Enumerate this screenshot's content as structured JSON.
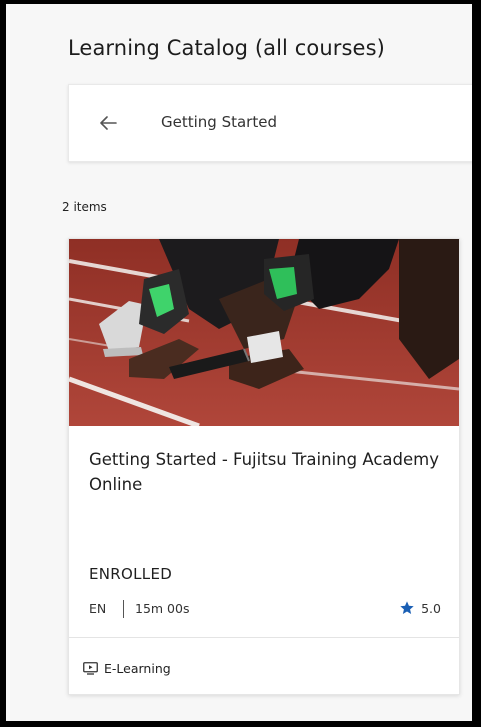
{
  "header": {
    "title": "Learning Catalog (all courses)"
  },
  "nav": {
    "back_icon": "arrow-left-icon",
    "label": "Getting Started"
  },
  "results": {
    "count_label": "2 items"
  },
  "card": {
    "image_icon": "sprinter-start-photo",
    "title": "Getting Started - Fujitsu Training Academy Online",
    "status": "ENROLLED",
    "language": "EN",
    "duration": "15m 00s",
    "rating": "5.0",
    "rating_icon": "star-icon",
    "type_icon": "e-learning-icon",
    "type": "E-Learning"
  },
  "colors": {
    "star": "#1a5fb4",
    "text": "#1f1f1f",
    "background": "#f7f7f7"
  }
}
